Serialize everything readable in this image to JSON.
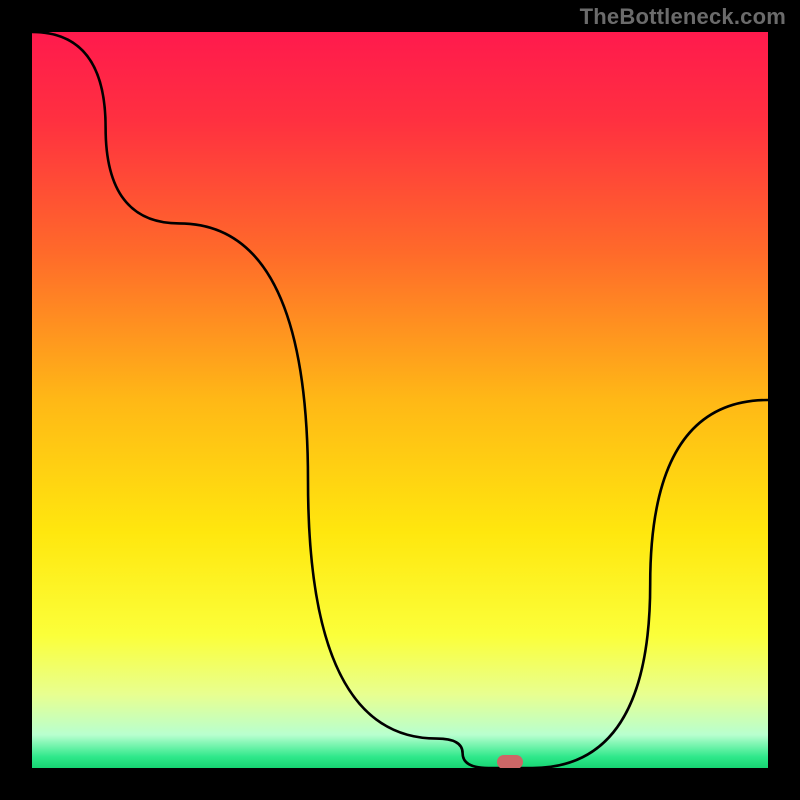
{
  "watermark": "TheBottleneck.com",
  "chart_data": {
    "type": "line",
    "title": "",
    "xlabel": "",
    "ylabel": "",
    "xlim": [
      0,
      100
    ],
    "ylim": [
      0,
      100
    ],
    "x": [
      0,
      20,
      55,
      62,
      68,
      100
    ],
    "values": [
      100,
      74,
      4,
      0,
      0,
      50
    ],
    "optimum_x": 65,
    "gradient_stops": [
      {
        "pos": 0.0,
        "color": "#ff1a4d"
      },
      {
        "pos": 0.12,
        "color": "#ff3040"
      },
      {
        "pos": 0.3,
        "color": "#ff6a2a"
      },
      {
        "pos": 0.5,
        "color": "#ffb816"
      },
      {
        "pos": 0.68,
        "color": "#ffe70e"
      },
      {
        "pos": 0.82,
        "color": "#fbff3a"
      },
      {
        "pos": 0.9,
        "color": "#e8ff90"
      },
      {
        "pos": 0.955,
        "color": "#b8ffcf"
      },
      {
        "pos": 0.985,
        "color": "#2ee88a"
      },
      {
        "pos": 1.0,
        "color": "#17d472"
      }
    ]
  }
}
